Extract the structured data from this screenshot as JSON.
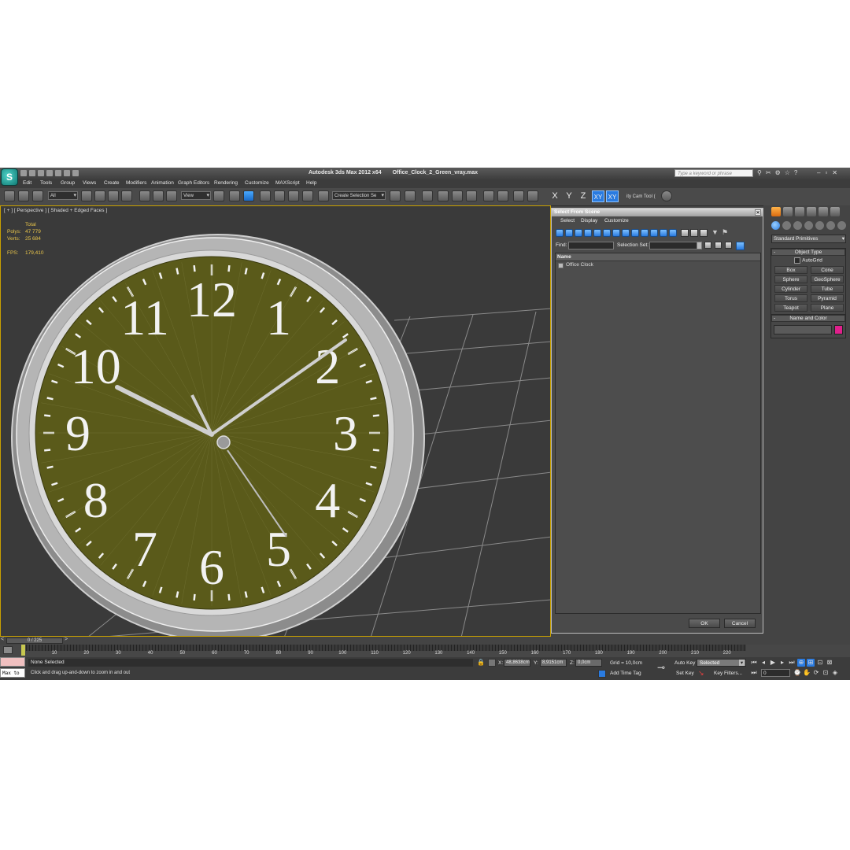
{
  "window": {
    "app_title": "Autodesk 3ds Max  2012 x64",
    "file_name": "Office_Clock_2_Green_vray.max",
    "search_placeholder": "Type a keyword or phrase"
  },
  "menu": [
    "Edit",
    "Tools",
    "Group",
    "Views",
    "Create",
    "Modifiers",
    "Animation",
    "Graph Editors",
    "Rendering",
    "Customize",
    "MAXScript",
    "Help"
  ],
  "toolbar": {
    "filter_value": "All",
    "ref_coord_value": "View",
    "selection_set_placeholder": "Create Selection Se",
    "axes": [
      "X",
      "Y",
      "Z",
      "XY",
      "XY"
    ],
    "cam_tool_label": "ity Cam Tool ("
  },
  "viewport": {
    "label": "[ + ] [ Perspective ] [ Shaded + Edged Faces ]",
    "stats_header": "Total",
    "stats": [
      {
        "label": "Polys:",
        "value": "47 779"
      },
      {
        "label": "Verts:",
        "value": "25 684"
      }
    ],
    "fps_label": "FPS:",
    "fps_value": "179,410",
    "clock_numerals": [
      "12",
      "1",
      "2",
      "3",
      "4",
      "5",
      "6",
      "7",
      "8",
      "9",
      "10",
      "11"
    ],
    "colors": {
      "clock_face": "#5a5a1a",
      "numerals": "#f2f2f2",
      "grid": "#8a8a8a",
      "background": "#3a3a3a"
    }
  },
  "select_dialog": {
    "title": "Select From Scene",
    "menus": [
      "Select",
      "Display",
      "Customize"
    ],
    "find_label": "Find:",
    "selection_set_label": "Selection Set:",
    "column_name": "Name",
    "items": [
      "Office Clock"
    ],
    "ok_label": "OK",
    "cancel_label": "Cancel"
  },
  "command_panel": {
    "category": "Standard Primitives",
    "object_type_title": "Object Type",
    "autogrid_label": "AutoGrid",
    "primitives": [
      "Box",
      "Cone",
      "Sphere",
      "GeoSphere",
      "Cylinder",
      "Tube",
      "Torus",
      "Pyramid",
      "Teapot",
      "Plane"
    ],
    "name_and_color_title": "Name and Color",
    "object_color": "#e0208c"
  },
  "timeline": {
    "slider_value": "0 / 225",
    "ticks": [
      "10",
      "20",
      "30",
      "40",
      "50",
      "60",
      "70",
      "80",
      "90",
      "100",
      "110",
      "120",
      "130",
      "140",
      "150",
      "160",
      "170",
      "180",
      "190",
      "200",
      "210",
      "220"
    ]
  },
  "status_bar": {
    "maxscript_text": "Max to",
    "selection_status": "None Selected",
    "prompt": "Click and drag up-and-down to zoom in and out",
    "x_label": "X:",
    "x_value": "48,8638cm",
    "y_label": "Y:",
    "y_value": "8,9151cm",
    "z_label": "Z:",
    "z_value": "0,0cm",
    "grid": "Grid = 10,0cm",
    "add_time_tag": "Add Time Tag",
    "auto_key": "Auto Key",
    "auto_key_value": "Selected",
    "set_key": "Set Key",
    "key_filters": "Key Filters...",
    "frame_value": "0"
  }
}
